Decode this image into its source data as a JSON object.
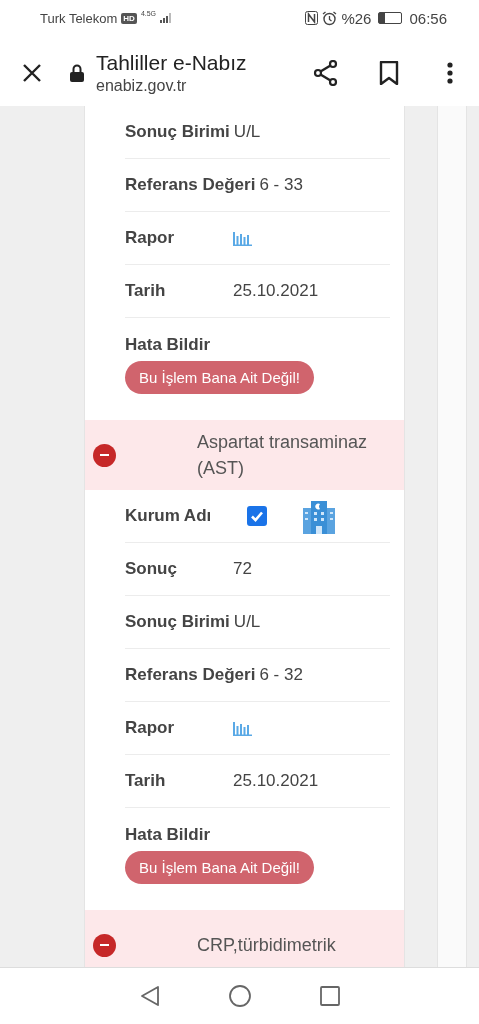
{
  "status_bar": {
    "carrier": "Turk Telekom",
    "hd_badge": "HD",
    "network": "4.5G",
    "battery_text": "%26",
    "time": "06:56"
  },
  "browser": {
    "title": "Tahliller e-Nabız",
    "url": "enabiz.gov.tr"
  },
  "tests": [
    {
      "rows": [
        {
          "kind": "value",
          "label": "Sonuç Birimi",
          "value": "U/L"
        },
        {
          "kind": "value",
          "label": "Referans Değeri",
          "value": "6 - 33"
        },
        {
          "kind": "report",
          "label": "Rapor"
        },
        {
          "kind": "value",
          "label": "Tarih",
          "value": "25.10.2021"
        },
        {
          "kind": "error",
          "label": "Hata Bildir",
          "button": "Bu İşlem Bana Ait Değil!"
        }
      ]
    },
    {
      "name": "Aspartat transaminaz (AST)",
      "expanded": true,
      "rows": [
        {
          "kind": "institution",
          "label": "Kurum Adı",
          "checked": true
        },
        {
          "kind": "value",
          "label": "Sonuç",
          "value": "72"
        },
        {
          "kind": "value",
          "label": "Sonuç Birimi",
          "value": "U/L"
        },
        {
          "kind": "value",
          "label": "Referans Değeri",
          "value": "6 - 32"
        },
        {
          "kind": "report",
          "label": "Rapor"
        },
        {
          "kind": "value",
          "label": "Tarih",
          "value": "25.10.2021"
        },
        {
          "kind": "error",
          "label": "Hata Bildir",
          "button": "Bu İşlem Bana Ait Değil!"
        }
      ]
    },
    {
      "name": "CRP,türbidimetrik",
      "expanded": true
    }
  ]
}
